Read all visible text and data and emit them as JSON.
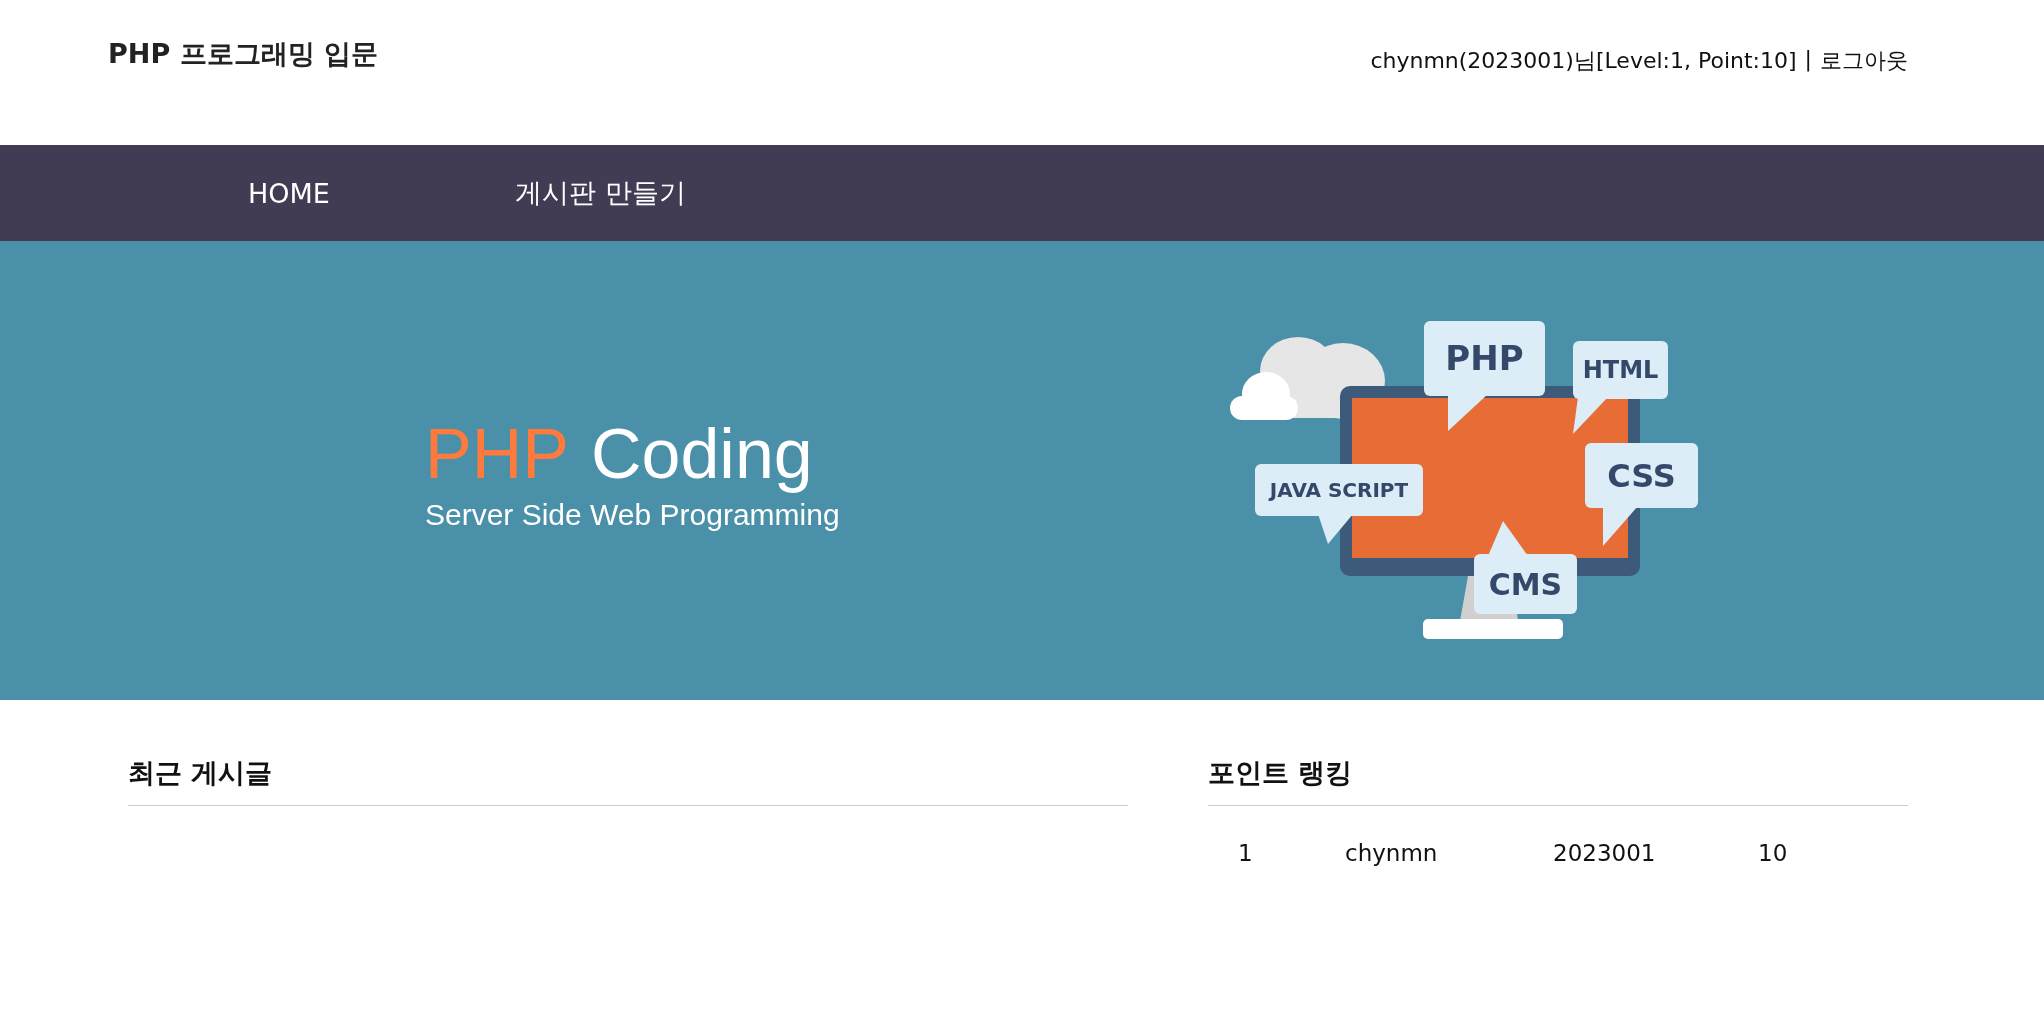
{
  "header": {
    "title": "PHP 프로그래밍 입문",
    "user_info": "chynmn(2023001)님[Level:1, Point:10]",
    "separator": "|",
    "logout": "로그아웃"
  },
  "nav": [
    {
      "label": "HOME"
    },
    {
      "label": "게시판 만들기"
    }
  ],
  "banner": {
    "title_accent": "PHP",
    "title_rest": "Coding",
    "subtitle": "Server Side Web Programming",
    "bubbles": [
      "PHP",
      "HTML",
      "JAVA SCRIPT",
      "CSS",
      "CMS"
    ]
  },
  "recent_posts": {
    "title": "최근 게시글"
  },
  "point_ranking": {
    "title": "포인트 랭킹",
    "rows": [
      {
        "rank": "1",
        "name": "chynmn",
        "id": "2023001",
        "point": "10"
      }
    ]
  }
}
